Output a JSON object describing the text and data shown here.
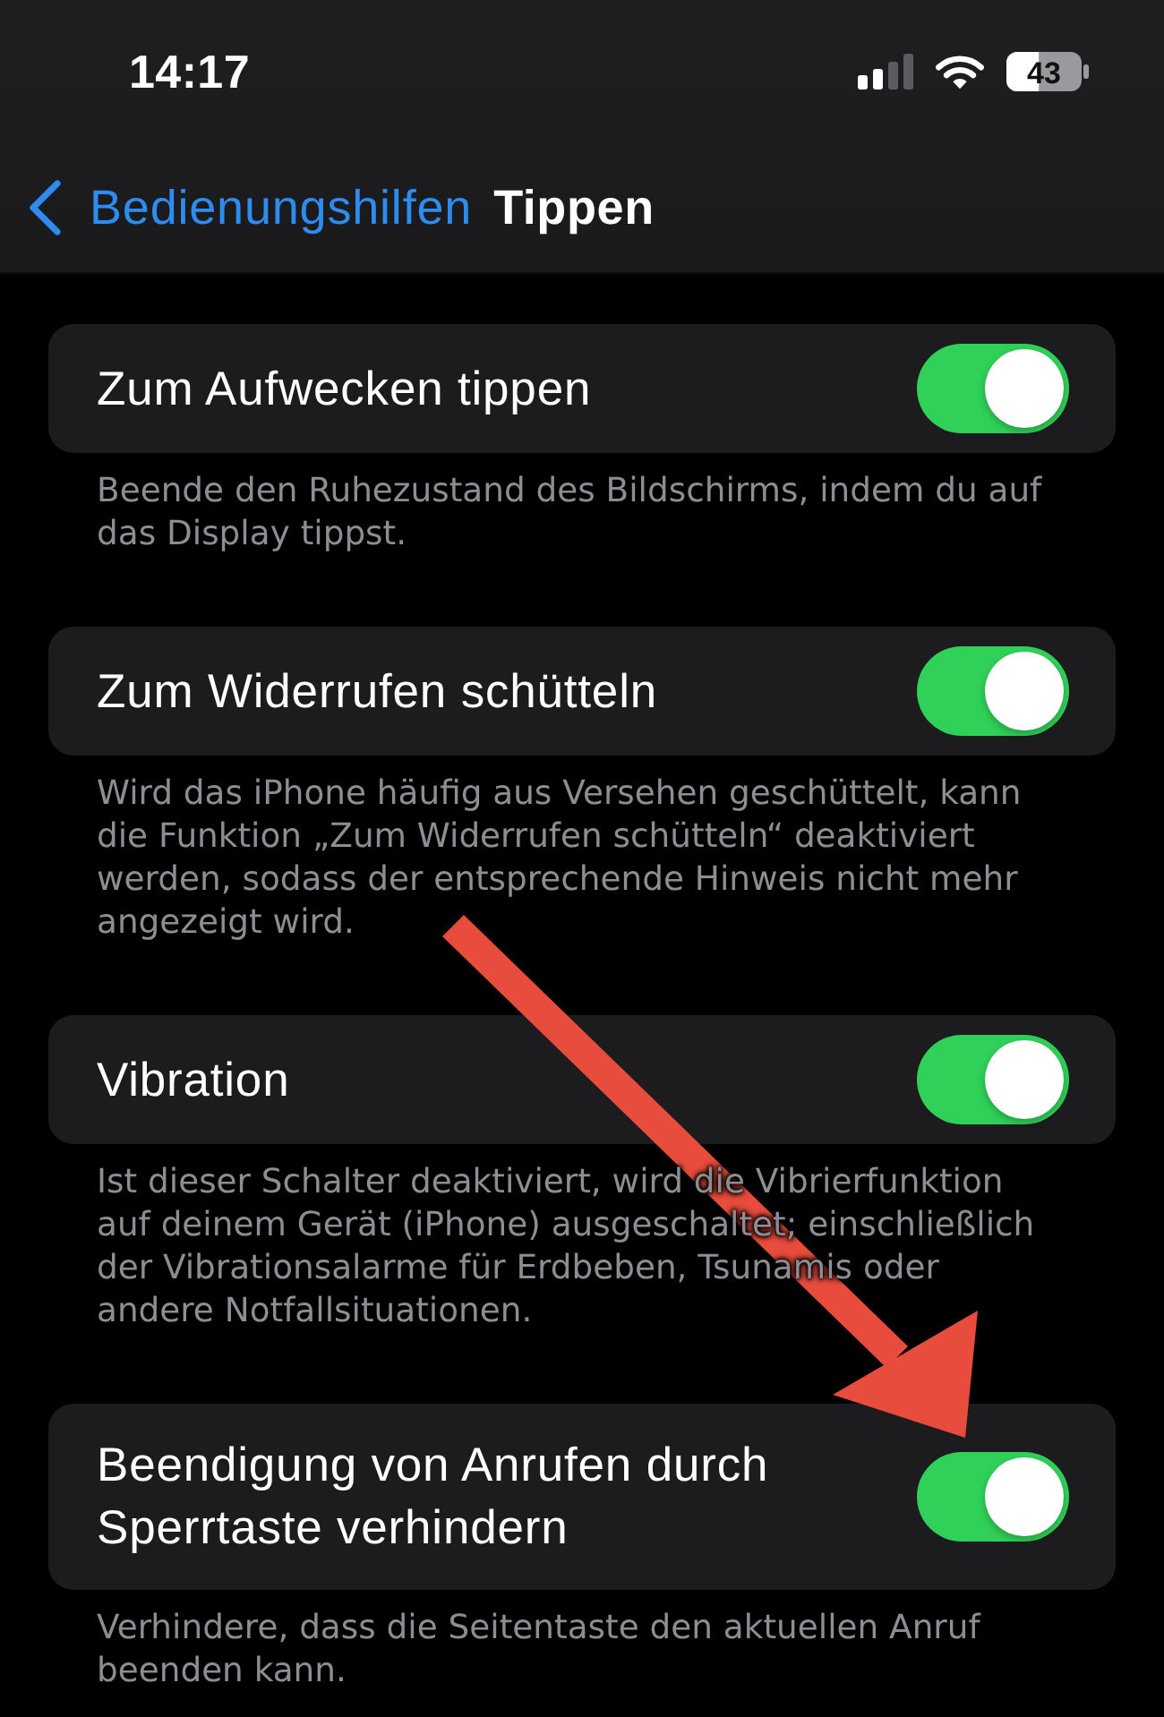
{
  "status_bar": {
    "time": "14:17",
    "battery": "43"
  },
  "nav_bar": {
    "back_label": "Bedienungshilfen",
    "title": "Tippen"
  },
  "sections": [
    {
      "label": "Zum Aufwecken tippen",
      "on": true,
      "footer": "Beende den Ruhezustand des Bildschirms, indem du auf das Display tippst."
    },
    {
      "label": "Zum Widerrufen schütteln",
      "on": true,
      "footer": "Wird das iPhone häufig aus Versehen geschüttelt, kann die Funktion „Zum Widerrufen schütteln“ deaktiviert werden, sodass der entsprechende Hinweis nicht mehr angezeigt wird."
    },
    {
      "label": "Vibration",
      "on": true,
      "footer": "Ist dieser Schalter deaktiviert, wird die Vibrierfunktion auf deinem Gerät (iPhone) ausgeschaltet; einschließlich der Vibrationsalarme für Erdbeben, Tsunamis oder andere Notfallsituationen."
    },
    {
      "label": "Beendigung von Anrufen durch Sperrtaste verhindern",
      "on": true,
      "footer": "Verhindere, dass die Seitentaste den aktuellen Anruf beenden kann."
    }
  ],
  "annotation": {
    "kind": "arrow"
  }
}
